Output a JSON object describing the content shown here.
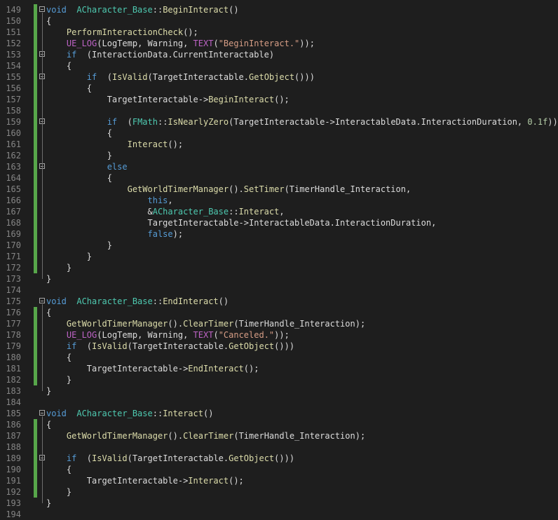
{
  "editor": {
    "language": "C++",
    "lines": [
      {
        "n": "149",
        "code": [
          [
            "kw",
            "void"
          ],
          [
            "",
            "  "
          ],
          [
            "ty",
            "ACharacter_Base"
          ],
          [
            "",
            "::"
          ],
          [
            "fn",
            "BeginInteract"
          ],
          [
            "",
            "()"
          ]
        ]
      },
      {
        "n": "150",
        "code": [
          [
            "",
            "{"
          ]
        ]
      },
      {
        "n": "151",
        "code": [
          [
            "",
            "    "
          ],
          [
            "fn",
            "PerformInteractionCheck"
          ],
          [
            "",
            "();"
          ]
        ]
      },
      {
        "n": "152",
        "code": [
          [
            "",
            "    "
          ],
          [
            "mac",
            "UE_LOG"
          ],
          [
            "",
            "(LogTemp, Warning, "
          ],
          [
            "mac",
            "TEXT"
          ],
          [
            "",
            "("
          ],
          [
            "str",
            "\"BeginInteract.\""
          ],
          [
            "",
            "));"
          ]
        ]
      },
      {
        "n": "153",
        "code": [
          [
            "",
            "    "
          ],
          [
            "kw",
            "if"
          ],
          [
            "",
            "  (InteractionData.CurrentInteractable)"
          ]
        ]
      },
      {
        "n": "154",
        "code": [
          [
            "",
            "    {"
          ]
        ]
      },
      {
        "n": "155",
        "code": [
          [
            "",
            "        "
          ],
          [
            "kw",
            "if"
          ],
          [
            "",
            "  ("
          ],
          [
            "fn",
            "IsValid"
          ],
          [
            "",
            "(TargetInteractable."
          ],
          [
            "fn",
            "GetObject"
          ],
          [
            "",
            "()))"
          ]
        ]
      },
      {
        "n": "156",
        "code": [
          [
            "",
            "        {"
          ]
        ]
      },
      {
        "n": "157",
        "code": [
          [
            "",
            "            TargetInteractable->"
          ],
          [
            "fn",
            "BeginInteract"
          ],
          [
            "",
            "();"
          ]
        ]
      },
      {
        "n": "158",
        "code": [
          [
            "",
            ""
          ]
        ]
      },
      {
        "n": "159",
        "code": [
          [
            "",
            "            "
          ],
          [
            "kw",
            "if"
          ],
          [
            "",
            "  ("
          ],
          [
            "ty",
            "FMath"
          ],
          [
            "",
            "::"
          ],
          [
            "fn",
            "IsNearlyZero"
          ],
          [
            "",
            "(TargetInteractable->InteractableData.InteractionDuration, "
          ],
          [
            "num",
            "0.1f"
          ],
          [
            "",
            "))"
          ]
        ]
      },
      {
        "n": "160",
        "code": [
          [
            "",
            "            {"
          ]
        ]
      },
      {
        "n": "161",
        "code": [
          [
            "",
            "                "
          ],
          [
            "fn",
            "Interact"
          ],
          [
            "",
            "();"
          ]
        ]
      },
      {
        "n": "162",
        "code": [
          [
            "",
            "            }"
          ]
        ]
      },
      {
        "n": "163",
        "code": [
          [
            "",
            "            "
          ],
          [
            "kw",
            "else"
          ]
        ]
      },
      {
        "n": "164",
        "code": [
          [
            "",
            "            {"
          ]
        ]
      },
      {
        "n": "165",
        "code": [
          [
            "",
            "                "
          ],
          [
            "fn",
            "GetWorldTimerManager"
          ],
          [
            "",
            "()."
          ],
          [
            "fn",
            "SetTimer"
          ],
          [
            "",
            "(TimerHandle_Interaction,"
          ]
        ]
      },
      {
        "n": "166",
        "code": [
          [
            "",
            "                    "
          ],
          [
            "kw",
            "this"
          ],
          [
            "",
            ","
          ]
        ]
      },
      {
        "n": "167",
        "code": [
          [
            "",
            "                    &"
          ],
          [
            "ty",
            "ACharacter_Base"
          ],
          [
            "",
            "::"
          ],
          [
            "fn",
            "Interact"
          ],
          [
            "",
            ","
          ]
        ]
      },
      {
        "n": "168",
        "code": [
          [
            "",
            "                    TargetInteractable->InteractableData.InteractionDuration,"
          ]
        ]
      },
      {
        "n": "169",
        "code": [
          [
            "",
            "                    "
          ],
          [
            "kw",
            "false"
          ],
          [
            "",
            ");"
          ]
        ]
      },
      {
        "n": "170",
        "code": [
          [
            "",
            "            }"
          ]
        ]
      },
      {
        "n": "171",
        "code": [
          [
            "",
            "        }"
          ]
        ]
      },
      {
        "n": "172",
        "code": [
          [
            "",
            "    }"
          ]
        ]
      },
      {
        "n": "173",
        "code": [
          [
            "",
            "}"
          ]
        ]
      },
      {
        "n": "174",
        "code": [
          [
            "",
            ""
          ]
        ]
      },
      {
        "n": "175",
        "code": [
          [
            "kw",
            "void"
          ],
          [
            "",
            "  "
          ],
          [
            "ty",
            "ACharacter_Base"
          ],
          [
            "",
            "::"
          ],
          [
            "fn",
            "EndInteract"
          ],
          [
            "",
            "()"
          ]
        ]
      },
      {
        "n": "176",
        "code": [
          [
            "",
            "{"
          ]
        ]
      },
      {
        "n": "177",
        "code": [
          [
            "",
            "    "
          ],
          [
            "fn",
            "GetWorldTimerManager"
          ],
          [
            "",
            "()."
          ],
          [
            "fn",
            "ClearTimer"
          ],
          [
            "",
            "(TimerHandle_Interaction);"
          ]
        ]
      },
      {
        "n": "178",
        "code": [
          [
            "",
            "    "
          ],
          [
            "mac",
            "UE_LOG"
          ],
          [
            "",
            "(LogTemp, Warning, "
          ],
          [
            "mac",
            "TEXT"
          ],
          [
            "",
            "("
          ],
          [
            "str",
            "\"Canceled.\""
          ],
          [
            "",
            "));"
          ]
        ]
      },
      {
        "n": "179",
        "code": [
          [
            "",
            "    "
          ],
          [
            "kw",
            "if"
          ],
          [
            "",
            "  ("
          ],
          [
            "fn",
            "IsValid"
          ],
          [
            "",
            "(TargetInteractable."
          ],
          [
            "fn",
            "GetObject"
          ],
          [
            "",
            "()))"
          ]
        ]
      },
      {
        "n": "180",
        "code": [
          [
            "",
            "    {"
          ]
        ]
      },
      {
        "n": "181",
        "code": [
          [
            "",
            "        TargetInteractable->"
          ],
          [
            "fn",
            "EndInteract"
          ],
          [
            "",
            "();"
          ]
        ]
      },
      {
        "n": "182",
        "code": [
          [
            "",
            "    }"
          ]
        ]
      },
      {
        "n": "183",
        "code": [
          [
            "",
            "}"
          ]
        ]
      },
      {
        "n": "184",
        "code": [
          [
            "",
            ""
          ]
        ]
      },
      {
        "n": "185",
        "code": [
          [
            "kw",
            "void"
          ],
          [
            "",
            "  "
          ],
          [
            "ty",
            "ACharacter_Base"
          ],
          [
            "",
            "::"
          ],
          [
            "fn",
            "Interact"
          ],
          [
            "",
            "()"
          ]
        ]
      },
      {
        "n": "186",
        "code": [
          [
            "",
            "{"
          ]
        ]
      },
      {
        "n": "187",
        "code": [
          [
            "",
            "    "
          ],
          [
            "fn",
            "GetWorldTimerManager"
          ],
          [
            "",
            "()."
          ],
          [
            "fn",
            "ClearTimer"
          ],
          [
            "",
            "(TimerHandle_Interaction);"
          ]
        ]
      },
      {
        "n": "188",
        "code": [
          [
            "",
            ""
          ]
        ]
      },
      {
        "n": "189",
        "code": [
          [
            "",
            "    "
          ],
          [
            "kw",
            "if"
          ],
          [
            "",
            "  ("
          ],
          [
            "fn",
            "IsValid"
          ],
          [
            "",
            "(TargetInteractable."
          ],
          [
            "fn",
            "GetObject"
          ],
          [
            "",
            "()))"
          ]
        ]
      },
      {
        "n": "190",
        "code": [
          [
            "",
            "    {"
          ]
        ]
      },
      {
        "n": "191",
        "code": [
          [
            "",
            "        TargetInteractable->"
          ],
          [
            "fn",
            "Interact"
          ],
          [
            "",
            "();"
          ]
        ]
      },
      {
        "n": "192",
        "code": [
          [
            "",
            "    }"
          ]
        ]
      },
      {
        "n": "193",
        "code": [
          [
            "",
            "}"
          ]
        ]
      },
      {
        "n": "194",
        "code": [
          [
            "",
            ""
          ]
        ]
      }
    ],
    "changed_line_numbers": [
      "149",
      "150",
      "151",
      "152",
      "153",
      "154",
      "155",
      "156",
      "157",
      "158",
      "159",
      "160",
      "161",
      "162",
      "163",
      "164",
      "165",
      "166",
      "167",
      "168",
      "169",
      "170",
      "171",
      "172",
      "176",
      "177",
      "178",
      "179",
      "180",
      "181",
      "182",
      "186",
      "187",
      "188",
      "189",
      "190",
      "191",
      "192"
    ],
    "fold_line_numbers": [
      "149",
      "153",
      "155",
      "159",
      "163",
      "175",
      "185",
      "189"
    ],
    "colors": {
      "background": "#1e1e1e",
      "line_number": "#858585",
      "keyword": "#569cd6",
      "type": "#4ec9b0",
      "function": "#dcdcaa",
      "string": "#d69d85",
      "macro": "#bd63c5",
      "number": "#b5cea8",
      "text": "#dcdcdc",
      "change_bar": "#57a64a"
    }
  }
}
